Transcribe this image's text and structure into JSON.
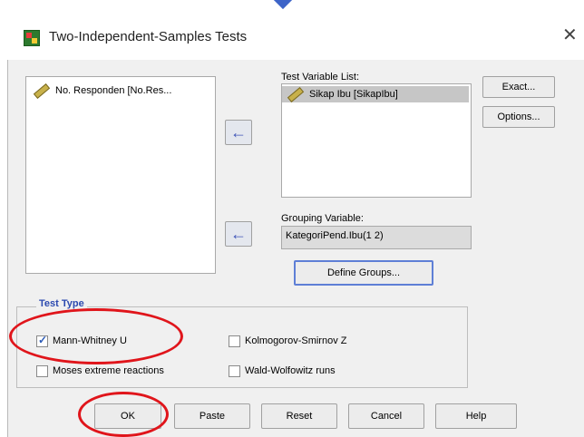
{
  "dialog": {
    "title": "Two-Independent-Samples Tests",
    "close_glyph": "✕"
  },
  "source_list": {
    "items": [
      "No. Responden [No.Res..."
    ]
  },
  "target": {
    "label": "Test Variable List:",
    "items": [
      "Sikap Ibu [SikapIbu]"
    ]
  },
  "grouping": {
    "label": "Grouping Variable:",
    "value": "KategoriPend.Ibu(1 2)",
    "define_button": "Define Groups..."
  },
  "side_buttons": {
    "exact": "Exact...",
    "options": "Options..."
  },
  "test_type": {
    "title": "Test Type",
    "options": [
      {
        "label": "Mann-Whitney U",
        "checked": true
      },
      {
        "label": "Kolmogorov-Smirnov Z",
        "checked": false
      },
      {
        "label": "Moses extreme reactions",
        "checked": false
      },
      {
        "label": "Wald-Wolfowitz runs",
        "checked": false
      }
    ]
  },
  "footer": {
    "ok": "OK",
    "paste": "Paste",
    "reset": "Reset",
    "cancel": "Cancel",
    "help": "Help"
  },
  "colors": {
    "annotation": "#e0151b",
    "accent": "#3f55b8"
  }
}
